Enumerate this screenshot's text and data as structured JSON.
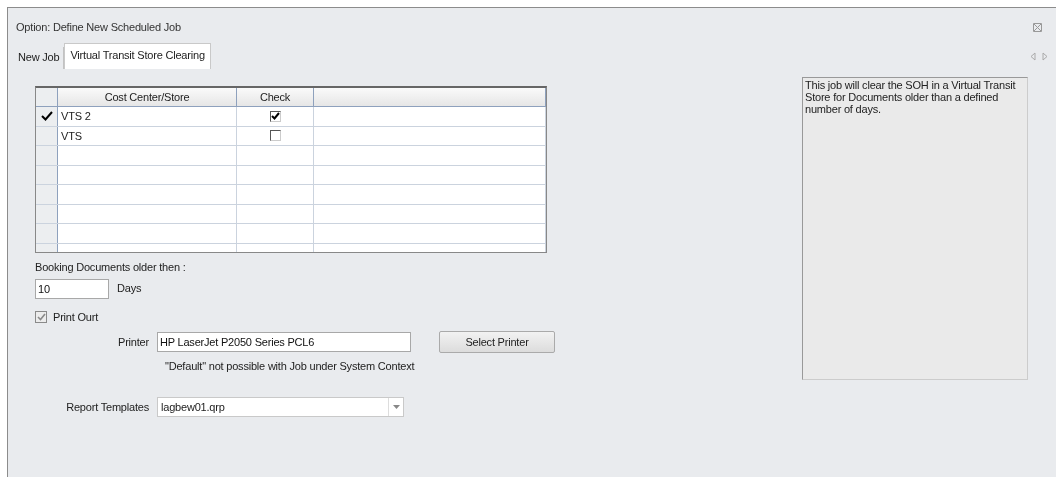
{
  "window": {
    "title": "Option: Define New Scheduled Job"
  },
  "tabs": [
    {
      "label": "New Job",
      "selected": false
    },
    {
      "label": "Virtual Transit Store Clearing",
      "selected": true
    }
  ],
  "grid": {
    "columns": [
      "Cost Center/Store",
      "Check"
    ],
    "rows": [
      {
        "store": "VTS 2",
        "checked": true,
        "current": true
      },
      {
        "store": "VTS",
        "checked": false,
        "current": false
      }
    ]
  },
  "booking": {
    "label": "Booking Documents older then :",
    "value": "10",
    "unit": "Days"
  },
  "print_out": {
    "label": "Print Ourt",
    "checked": true,
    "disabled": true
  },
  "printer": {
    "label": "Printer",
    "value": "HP LaserJet P2050 Series PCL6",
    "button": "Select Printer",
    "note": "\"Default\" not possible with Job under System Context"
  },
  "report_templates": {
    "label": "Report Templates",
    "value": "lagbew01.qrp"
  },
  "description": "This job will clear the SOH in a Virtual Transit Store for Documents older than a defined number of days."
}
